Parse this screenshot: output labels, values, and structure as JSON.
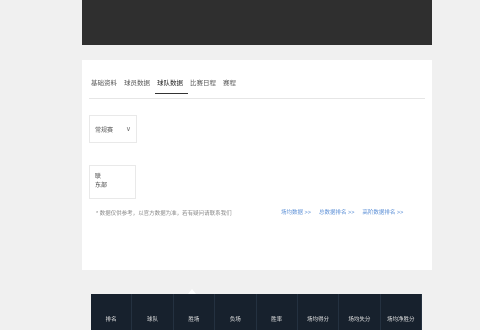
{
  "tabs": [
    {
      "label": "基础资料"
    },
    {
      "label": "球员数据"
    },
    {
      "label": "球队数据"
    },
    {
      "label": "比赛日程"
    },
    {
      "label": "赛程"
    }
  ],
  "season_select": {
    "value": "常规赛"
  },
  "filter": {
    "line1": "联",
    "line2": "东部"
  },
  "note": "* 数据仅供参考，以官方数据为准，若有疑问请联系我们",
  "links": [
    "场均数据 >>",
    "总数据排名 >>",
    "高阶数据排名 >>"
  ],
  "table": {
    "headers": [
      "排名",
      "球队",
      "胜场",
      "负场",
      "胜率",
      "场均得分",
      "场均失分",
      "场均净胜分"
    ]
  }
}
